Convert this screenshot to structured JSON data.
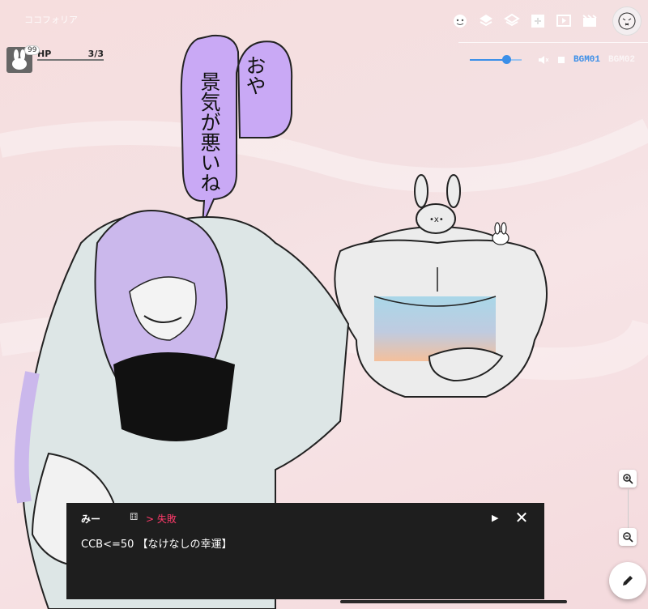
{
  "room": {
    "name": "ココフォリア"
  },
  "toolbar": {
    "icons": [
      "character-icon",
      "layers-icon",
      "layers-outline-icon",
      "add-panel-icon",
      "video-icon",
      "scene-icon",
      "avatar-icon"
    ]
  },
  "bgm": {
    "volume": 0.75,
    "track1": "BGM01",
    "track2": "BGM02"
  },
  "character": {
    "badge": "99",
    "stat_label": "HP",
    "stat_value": "3/3"
  },
  "bubble": {
    "line1": "おや",
    "line2": "景気が悪いね"
  },
  "chat": {
    "name": "みー",
    "result": "> 失敗",
    "message": "CCB<=50 【なけなしの幸運】",
    "close": "✕",
    "play": "▶"
  },
  "colors": {
    "accent": "#3b8fe8",
    "fail": "#ff3b6b",
    "bubble": "#c9a9f5",
    "chat_bg": "#1e1e1e"
  }
}
